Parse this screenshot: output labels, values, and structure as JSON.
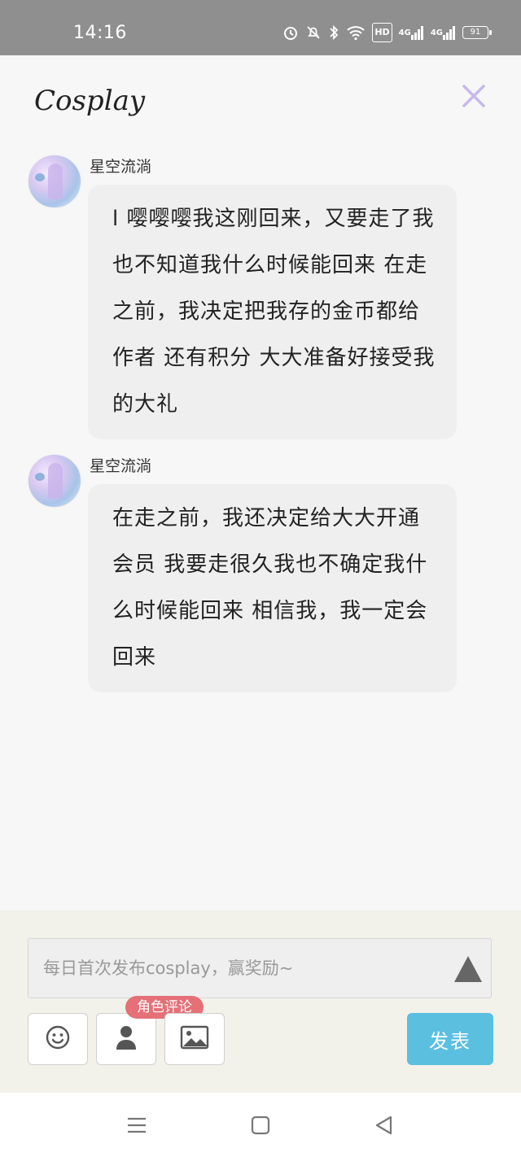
{
  "status_bar": {
    "time": "14:16",
    "hd_label": "HD",
    "net1": "4G",
    "net2": "4G",
    "battery": "91"
  },
  "header": {
    "title": "Cosplay"
  },
  "messages": [
    {
      "username": "星空流淌",
      "text": "l 嘤嘤嘤我这刚回来，又要走了我也不知道我什么时候能回来 在走之前，我决定把我存的金币都给作者 还有积分 大大准备好接受我的大礼"
    },
    {
      "username": "星空流淌",
      "text": "在走之前，我还决定给大大开通会员 我要走很久我也不确定我什么时候能回来 相信我，我一定会回来"
    }
  ],
  "composer": {
    "placeholder": "每日首次发布cosplay，赢奖励~",
    "role_badge": "角色评论",
    "post_label": "发表"
  },
  "icons": [
    "alarm-icon",
    "mute-icon",
    "bluetooth-icon",
    "wifi-icon",
    "signal-icon",
    "battery-icon",
    "close-icon",
    "send-arrow-icon",
    "emoji-icon",
    "person-icon",
    "image-icon",
    "menu-icon",
    "home-icon",
    "back-icon"
  ],
  "colors": {
    "accent_blue": "#5bbfe0",
    "badge_red": "#e57077",
    "close_purple": "#c8b8ec"
  }
}
